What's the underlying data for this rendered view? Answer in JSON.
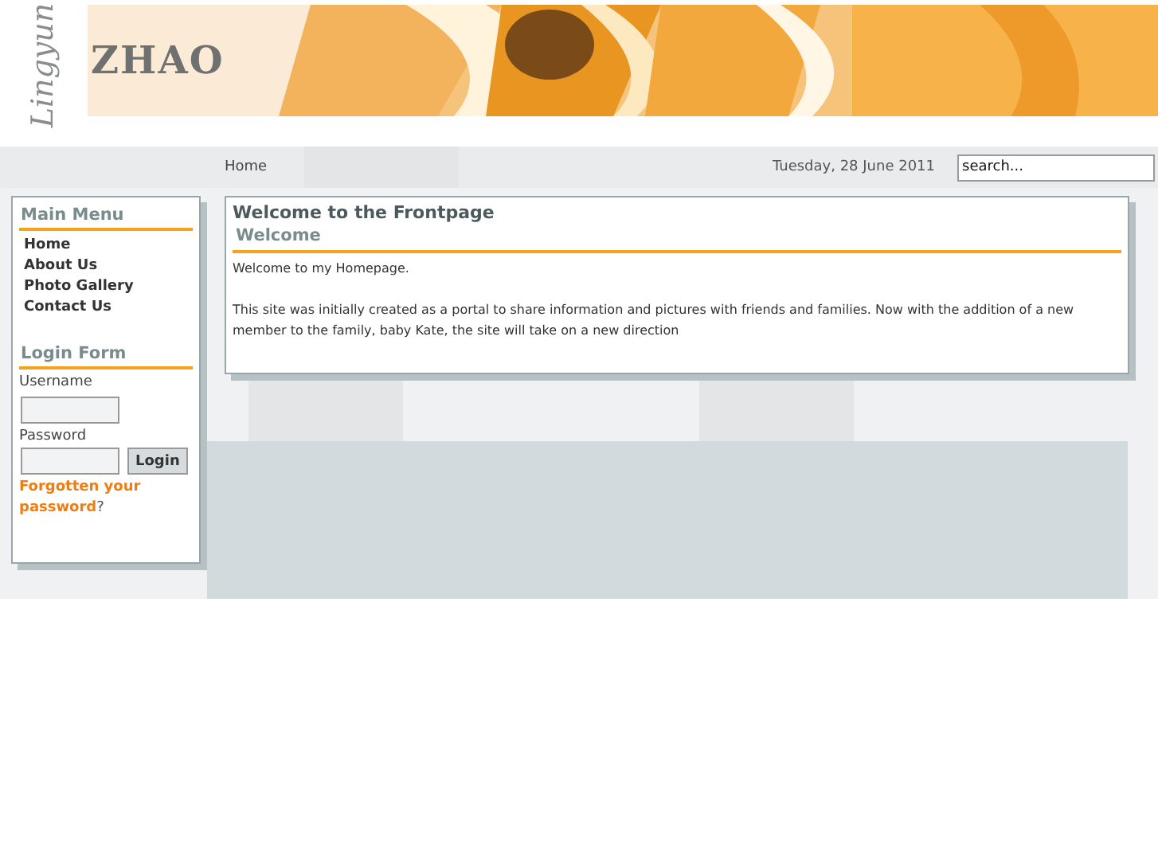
{
  "header": {
    "script_name": "Lingyun",
    "name": "ZHAO"
  },
  "breadcrumb": "Home",
  "date": "Tuesday, 28 June 2011",
  "search": {
    "placeholder": "search..."
  },
  "main_menu": {
    "title": "Main Menu",
    "items": [
      {
        "label": "Home"
      },
      {
        "label": "About Us"
      },
      {
        "label": "Photo Gallery"
      },
      {
        "label": "Contact Us"
      }
    ]
  },
  "login_form": {
    "title": "Login Form",
    "username_label": "Username",
    "password_label": "Password",
    "button": "Login",
    "forgot_link": "Forgotten your",
    "forgot_link_2": "password",
    "forgot_suffix": "?"
  },
  "content": {
    "page_title": "Welcome to the Frontpage",
    "article_title": "Welcome",
    "paragraphs": [
      "Welcome to my Homepage.",
      "This site was initially created as a portal to share information and pictures with friends and families. Now with the addition of a new member to the family, baby Kate, the site will take on a new direction"
    ]
  }
}
